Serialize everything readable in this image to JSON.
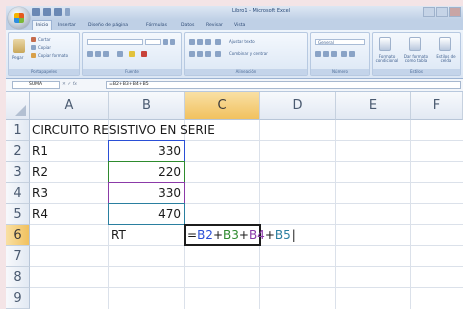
{
  "window": {
    "title": "Libro1 - Microsoft Excel"
  },
  "ribbon": {
    "tabs": [
      "Inicio",
      "Insertar",
      "Diseño de página",
      "Fórmulas",
      "Datos",
      "Revisar",
      "Vista"
    ],
    "active_tab": "Inicio",
    "groups": {
      "clipboard": {
        "label": "Portapapeles",
        "paste": "Pegar",
        "cut": "Cortar",
        "copy": "Copiar",
        "format_painter": "Copiar formato"
      },
      "font": {
        "label": "Fuente"
      },
      "alignment": {
        "label": "Alineación",
        "wrap_text": "Ajustar texto",
        "merge": "Combinar y centrar"
      },
      "number": {
        "label": "Número",
        "format": "General"
      },
      "styles": {
        "label": "Estilos",
        "conditional": "Formato condicional",
        "table": "Dar formato como tabla",
        "cell_styles": "Estilos de celda"
      }
    }
  },
  "formula_bar": {
    "name_box": "SUMA",
    "fx_label": "fx",
    "formula": "=B2+B3+B4+B5"
  },
  "sheet": {
    "columns": [
      "A",
      "B",
      "C",
      "D",
      "E",
      "F"
    ],
    "rows": [
      "1",
      "2",
      "3",
      "4",
      "5",
      "6",
      "7",
      "8",
      "9"
    ],
    "selected_column": "C",
    "selected_row": "6",
    "cells": {
      "A1": "CIRCUITO RESISTIVO EN SERIE",
      "A2": "R1",
      "A3": "R2",
      "A4": "R3",
      "A5": "R4",
      "B2": "330",
      "B3": "220",
      "B4": "330",
      "B5": "470",
      "B6": "RT"
    },
    "active_formula_parts": [
      {
        "text": "=",
        "color": "#1a1a1a"
      },
      {
        "text": "B2",
        "color": "#2a4fd6"
      },
      {
        "text": "+",
        "color": "#1a1a1a"
      },
      {
        "text": "B3",
        "color": "#2e8b2e"
      },
      {
        "text": "+",
        "color": "#1a1a1a"
      },
      {
        "text": "B4",
        "color": "#8b3aa8"
      },
      {
        "text": "+",
        "color": "#1a1a1a"
      },
      {
        "text": "B5",
        "color": "#2a7fa0"
      }
    ],
    "reference_colors": {
      "B2": "#2a4fd6",
      "B3": "#2e8b2e",
      "B4": "#8b3aa8",
      "B5": "#2a7fa0"
    }
  }
}
